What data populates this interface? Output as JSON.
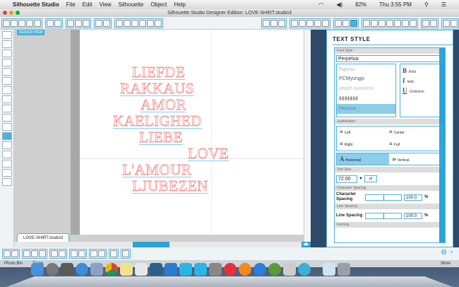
{
  "menubar": {
    "app": "Silhouette Studio",
    "items": [
      "File",
      "Edit",
      "View",
      "Silhouette",
      "Object",
      "Help"
    ],
    "battery": "82%",
    "clock": "Thu 3:55 PM"
  },
  "window": {
    "title": "Silhouette Studio Designer Edition: LOVE-SHIRT.studio3"
  },
  "workarea": {
    "design_view_label": "DESIGN VIEW",
    "document_tab": "LOVE-SHIRT.studio3",
    "scroll_arrows": "◀▶"
  },
  "canvas": {
    "words": [
      "LIEFDE",
      "RAKKAUS",
      "AMOR",
      "KAELIGHED",
      "LIEBE",
      "LOVE",
      "L'AMOUR",
      "LJUBEZEN"
    ],
    "text_color": "#f08080",
    "underline_color": "#7fd0ee"
  },
  "panel": {
    "title": "TEXT STYLE",
    "font_style_label": "Font Style",
    "font_value": "Perpetua",
    "font_list": [
      "Papyrus",
      "PCMyungjo",
      "peach sundress",
      "▮▮▮▮▮▮▮",
      "Perpetua"
    ],
    "styles": {
      "bold": "Bold",
      "italic": "Italic",
      "underline": "Underline"
    },
    "justification_label": "Justification",
    "justification": [
      "Left",
      "Center",
      "Right",
      "Full"
    ],
    "orientation": {
      "horizontal": "Horizontal",
      "vertical": "Vertical"
    },
    "text_size_label": "Text Size",
    "text_size": "72.00",
    "unit": "pt",
    "char_spacing_header": "Character Spacing",
    "char_spacing_label": "Character Spacing",
    "char_spacing_value": "100.0",
    "line_spacing_header": "Line Spacing",
    "line_spacing_label": "Line Spacing",
    "line_spacing_value": "100.0",
    "percent": "%",
    "kerning_label": "Kerning"
  },
  "dock": {
    "labels": [
      "Photo Bin",
      "Trace",
      "More"
    ]
  },
  "accent": "#2ba3d5"
}
